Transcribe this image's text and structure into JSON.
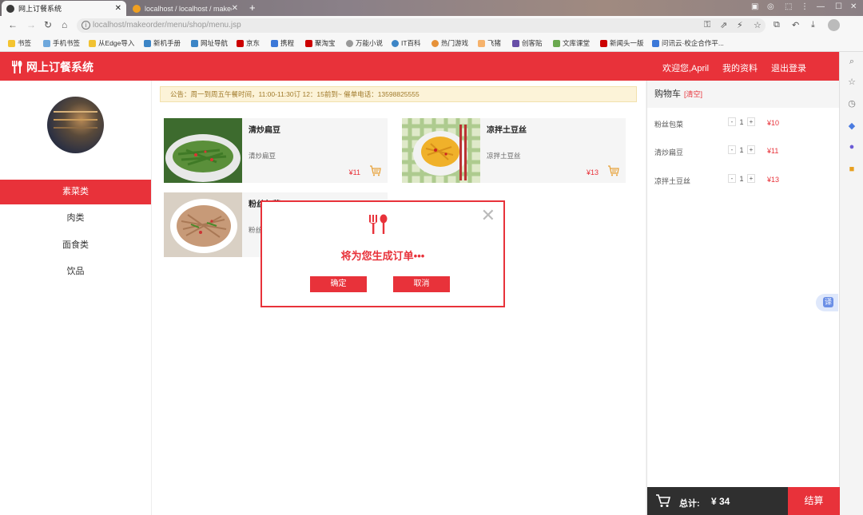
{
  "browser": {
    "tabs": [
      {
        "title": "网上订餐系统",
        "active": true
      },
      {
        "title": "localhost / localhost / makeord",
        "active": false
      }
    ],
    "url": "localhost/makeorder/menu/shop/menu.jsp",
    "bookmarks": [
      "书签",
      "手机书签",
      "从Edge导入",
      "新机手册",
      "网址导航",
      "京东",
      "携程",
      "聚淘宝",
      "万能小说",
      "IT百科",
      "热门游戏",
      "飞猪",
      "创客贴",
      "文库课堂",
      "新闻头一版",
      "问讯云·校企合作平..."
    ],
    "window_controls": {
      "minimize": "—",
      "maximize": "☐",
      "close": "✕"
    }
  },
  "header": {
    "title": "网上订餐系统",
    "welcome": "欢迎您,April",
    "profile_link": "我的资料",
    "logout_link": "退出登录"
  },
  "sidebar": {
    "items": [
      {
        "label": "素菜类",
        "active": true
      },
      {
        "label": "肉类",
        "active": false
      },
      {
        "label": "面食类",
        "active": false
      },
      {
        "label": "饮品",
        "active": false
      }
    ]
  },
  "notice": "公告：周一到周五午餐时间，11:00-11:30订 12：15前到~ 催单电话：13598825555",
  "dishes": [
    {
      "name": "清炒扁豆",
      "desc": "清炒扁豆",
      "price": "¥11"
    },
    {
      "name": "凉拌土豆丝",
      "desc": "凉拌土豆丝",
      "price": "¥13"
    },
    {
      "name": "粉丝包菜",
      "desc": "粉丝",
      "price": ""
    }
  ],
  "modal": {
    "message": "将为您生成订单•••",
    "confirm": "确定",
    "cancel": "取消"
  },
  "cart": {
    "title": "购物车",
    "clear": "[清空]",
    "items": [
      {
        "name": "粉丝包菜",
        "qty": "1",
        "price": "¥10"
      },
      {
        "name": "清炒扁豆",
        "qty": "1",
        "price": "¥11"
      },
      {
        "name": "凉拌土豆丝",
        "qty": "1",
        "price": "¥13"
      }
    ],
    "total_label": "总计:",
    "total_value": "¥ 34",
    "checkout": "结算"
  },
  "colors": {
    "accent": "#e8323a",
    "notice_bg": "#fcf3d8",
    "footer": "#2f2f2f"
  }
}
